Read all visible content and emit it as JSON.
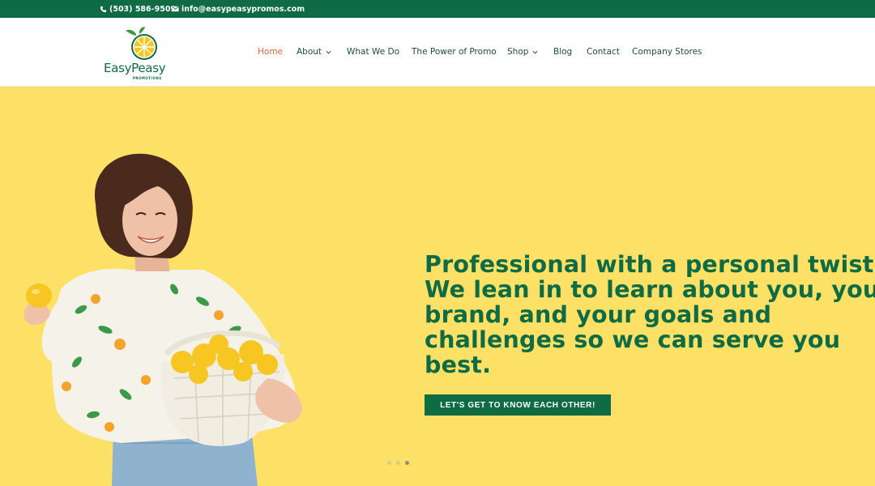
{
  "topbar": {
    "phone": "(503) 586-9509",
    "email": "info@easypeasypromos.com",
    "phone_icon": "phone-icon",
    "email_icon": "envelope-icon"
  },
  "logo": {
    "name": "EasyPeasy",
    "tagline": "PROMOTIONS"
  },
  "nav": {
    "items": [
      {
        "label": "Home",
        "active": true
      },
      {
        "label": "About",
        "dropdown": true
      },
      {
        "label": "What We Do"
      },
      {
        "label": "The Power of Promo"
      },
      {
        "label": "Shop",
        "dropdown": true
      },
      {
        "label": "Blog"
      },
      {
        "label": "Contact"
      },
      {
        "label": "Company Stores"
      }
    ]
  },
  "hero": {
    "headline_lines": [
      "Professional with a personal twist.",
      "We lean in to learn about you, your",
      "brand, and your goals and",
      "challenges so we can serve you",
      "best."
    ],
    "cta_label": "LET'S GET TO KNOW EACH OTHER!",
    "slides": 3,
    "active_slide": 3
  },
  "colors": {
    "brand_green": "#0e6b44",
    "hero_yellow": "#fde166",
    "active_nav": "#e0643a"
  }
}
